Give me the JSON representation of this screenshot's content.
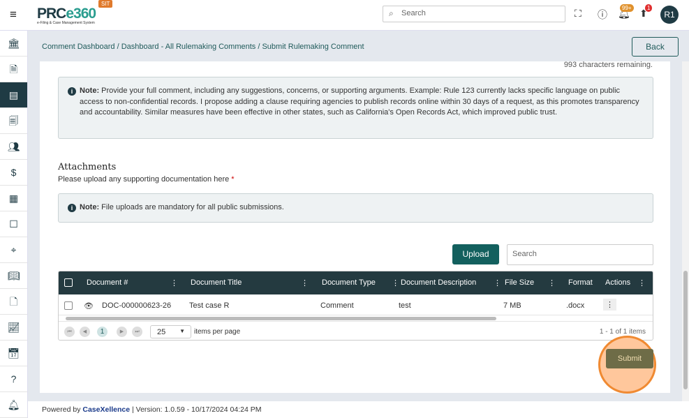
{
  "header": {
    "logo": "PRCe360",
    "logo_tagline": "e-Filing & Case Management System",
    "env_badge": "SIT",
    "search_placeholder": "Search",
    "notifications_count": "99+",
    "uploads_count": "1",
    "avatar": "R1"
  },
  "sidebar": {
    "items": [
      "bank",
      "document",
      "comment",
      "document-search",
      "users",
      "dollar-document",
      "building",
      "form",
      "scan",
      "book",
      "file",
      "chart",
      "calendar",
      "help-book",
      "bell"
    ],
    "active": 2
  },
  "breadcrumb": "Comment Dashboard / Dashboard - All Rulemaking Comments / Submit Rulemaking Comment",
  "back_label": "Back",
  "chars_remaining": "993 characters remaining.",
  "note1": {
    "label": "Note:",
    "text": " Provide your full comment, including any suggestions, concerns, or supporting arguments. Example: Rule 123 currently lacks specific language on public access to non-confidential records. I propose adding a clause requiring agencies to publish records online within 30 days of a request, as this promotes transparency and accountability. Similar measures have been effective in other states, such as California's Open Records Act, which improved public trust."
  },
  "attachments": {
    "title": "Attachments",
    "subtitle": "Please upload any supporting documentation here",
    "required": "*"
  },
  "note2": {
    "label": "Note:",
    "text": " File uploads are mandatory for all public submissions."
  },
  "upload_label": "Upload",
  "table_search_placeholder": "Search",
  "table": {
    "columns": [
      "Document #",
      "Document Title",
      "Document Type",
      "Document Description",
      "File Size",
      "Format",
      "Actions"
    ],
    "rows": [
      {
        "doc": "DOC-000000623-26",
        "title": "Test case R",
        "type": "Comment",
        "description": "test",
        "size": "7 MB",
        "format": ".docx"
      }
    ]
  },
  "pager": {
    "page": "1",
    "page_size": "25",
    "per_page_label": "items per page",
    "summary": "1 - 1 of 1 items"
  },
  "submit_label": "Submit",
  "footer": {
    "powered": "Powered by",
    "brand": "CaseXellence",
    "version": "Version: 1.0.59 - 10/17/2024 04:24 PM"
  }
}
